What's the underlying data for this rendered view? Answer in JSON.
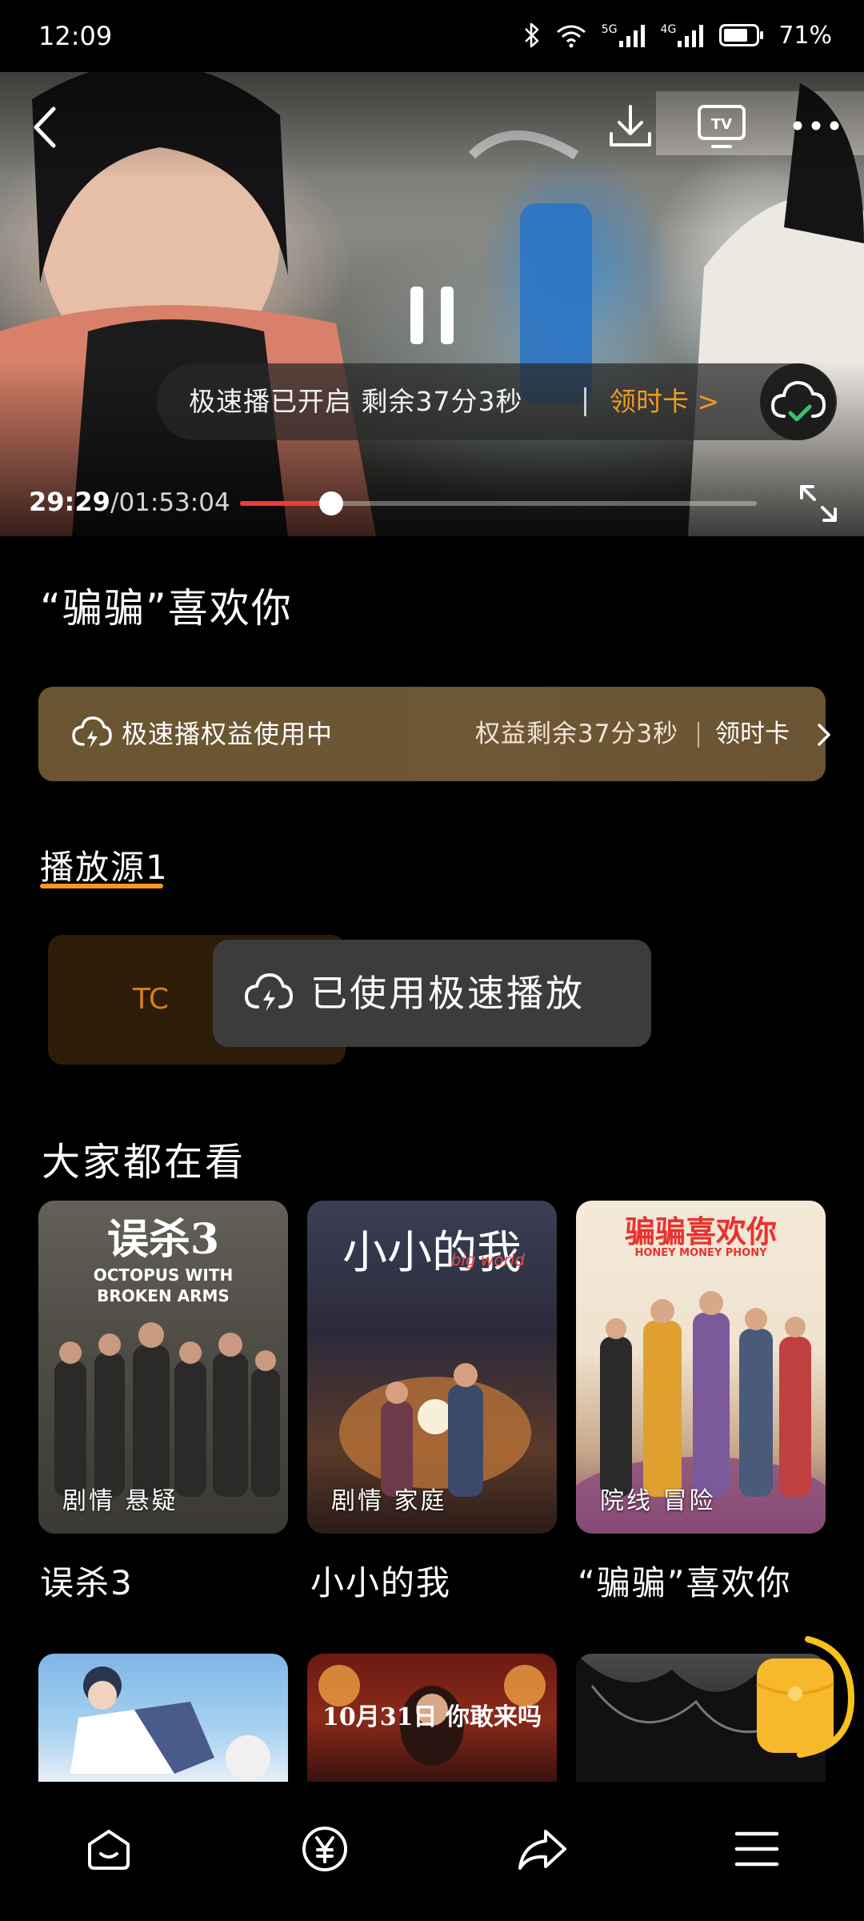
{
  "status_bar": {
    "time": "12:09",
    "battery": "71%",
    "net_5g": "5G",
    "net_4g": "4G"
  },
  "player": {
    "speed_notice": "极速播已开启 剩余37分3秒",
    "speed_link": "领时卡 >",
    "current_time": "29:29",
    "total_time": "/01:53:04",
    "progress_fraction": 0.176
  },
  "video": {
    "title": "“骗骗”喜欢你"
  },
  "banner": {
    "left_text": "极速播权益使用中",
    "right_text": "权益剩余37分3秒",
    "link": "领时卡"
  },
  "source": {
    "title": "播放源1",
    "chip_label": "TC"
  },
  "toast": {
    "text": "已使用极速播放"
  },
  "recommend": {
    "title": "大家都在看",
    "items": [
      {
        "title": "误杀3",
        "tag": "剧情 悬疑",
        "poster_title": "误杀3",
        "poster_sub": "OCTOPUS WITH BROKEN ARMS"
      },
      {
        "title": "小小的我",
        "tag": "剧情 家庭",
        "poster_title": "小小的我",
        "poster_sub": "big world"
      },
      {
        "title": "“骗骗”喜欢你",
        "tag": "院线 冒险",
        "poster_title": "骗骗喜欢你",
        "poster_sub": "HONEY MONEY PHONY"
      }
    ],
    "row2_items": [
      {
        "poster_title": ""
      },
      {
        "poster_title": "10月31日 你敢来吗"
      },
      {
        "poster_title": ""
      }
    ]
  },
  "colors": {
    "accent": "#f39a1e",
    "progress": "#ee3b3b",
    "banner": "#6b5531",
    "toast": "#3c3c3d"
  },
  "icons": {
    "back": "chevron-left-icon",
    "download": "download-icon",
    "cast": "tv-cast-icon",
    "more": "more-icon",
    "pause": "pause-icon",
    "fullscreen": "fullscreen-icon",
    "cloud": "cloud-check-icon",
    "home": "home-icon",
    "coin": "yuan-coin-icon",
    "share": "share-icon",
    "menu": "menu-icon"
  }
}
